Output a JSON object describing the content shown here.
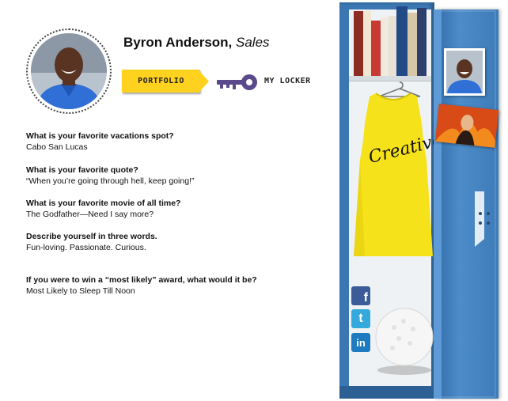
{
  "profile": {
    "name": "Byron Anderson,",
    "department": "Sales"
  },
  "nav": {
    "portfolio_label": "PORTFOLIO",
    "locker_label": "MY LOCKER"
  },
  "qa": [
    {
      "question": "What is your favorite vacations spot?",
      "answer": "Cabo San Lucas"
    },
    {
      "question": "What is your favorite quote?",
      "answer": "“When you’re going through hell, keep going!”"
    },
    {
      "question": "What is your favorite movie of all time?",
      "answer": "The Godfather—Need I say more?"
    },
    {
      "question": "Describe yourself in three words.",
      "answer": "Fun-loving. Passionate. Curious."
    },
    {
      "question": "If you were to win a “most likely” award, what would it be?",
      "answer": "Most Likely to Sleep Till Noon"
    }
  ],
  "locker": {
    "shirt_text": "Creative",
    "social": [
      {
        "icon": "facebook-icon",
        "glyph": "f"
      },
      {
        "icon": "twitter-icon",
        "glyph": "t"
      },
      {
        "icon": "linkedin-icon",
        "glyph": "in"
      }
    ]
  },
  "colors": {
    "accent_yellow": "#ffd21f",
    "locker_blue": "#3b78b3",
    "key_purple": "#5b4a8b"
  }
}
